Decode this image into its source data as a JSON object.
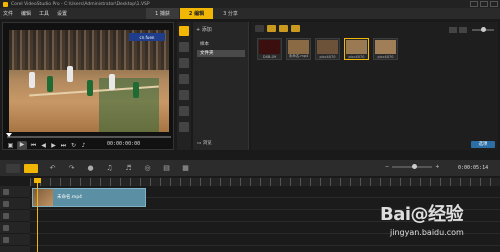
{
  "titlebar": {
    "title": "Corel VideoStudio Pro - C:\\Users\\Administrator\\Desktop\\1.VSP"
  },
  "menu": [
    "文件",
    "编辑",
    "工具",
    "设置"
  ],
  "steps": [
    {
      "label": "1 捕获",
      "active": false
    },
    {
      "label": "2 编辑",
      "active": true
    },
    {
      "label": "3 分享",
      "active": false
    }
  ],
  "preview": {
    "scorebug": "cn.fuen",
    "timecode": "00:00:00:00"
  },
  "library": {
    "add_label": "添加",
    "folders": [
      {
        "label": "样本",
        "selected": false
      },
      {
        "label": "文件夹",
        "selected": true
      }
    ],
    "browse_label": "浏览",
    "thumbnails": [
      {
        "caption": "DXB-09",
        "color": "#3c0f0f",
        "selected": false
      },
      {
        "caption": "未命名.mp4",
        "color": "#8a6a45",
        "selected": false
      },
      {
        "caption": "picc4070",
        "color": "#6b5238",
        "selected": false
      },
      {
        "caption": "picc4070",
        "color": "#9a7a52",
        "selected": true
      },
      {
        "caption": "picc4070",
        "color": "#a07f58",
        "selected": false
      }
    ],
    "options_label": "选项"
  },
  "timeline": {
    "time": "0:00:05:14",
    "clip_label": "未命名.mp4"
  },
  "watermark": {
    "brand": "Bai@经验",
    "url": "jingyan.baidu.com"
  }
}
